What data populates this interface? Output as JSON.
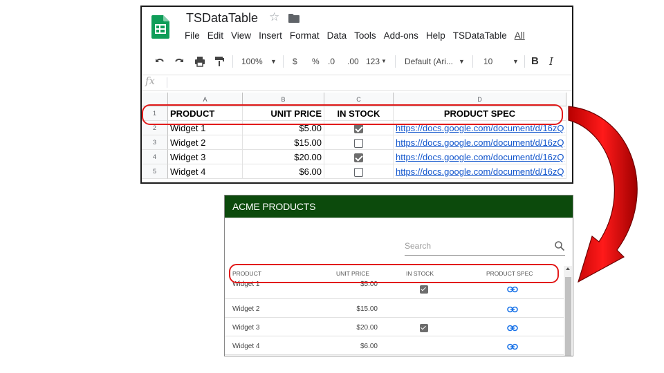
{
  "sheet": {
    "title": "TSDataTable",
    "menu": [
      "File",
      "Edit",
      "View",
      "Insert",
      "Format",
      "Data",
      "Tools",
      "Add-ons",
      "Help",
      "TSDataTable",
      "All"
    ],
    "toolbar": {
      "zoom": "100%",
      "currency": "$",
      "percent": "%",
      "dec_less": ".0",
      "dec_more": ".00",
      "more_formats": "123",
      "font": "Default (Ari...",
      "font_size": "10",
      "bold": "B",
      "italic": "I"
    },
    "fx": "fx",
    "columns": [
      "A",
      "B",
      "C",
      "D"
    ],
    "row_numbers": [
      "1",
      "2",
      "3",
      "4",
      "5"
    ],
    "headers": [
      "PRODUCT",
      "UNIT PRICE",
      "IN STOCK",
      "PRODUCT SPEC"
    ],
    "rows": [
      {
        "product": "Widget 1",
        "price": "$5.00",
        "in_stock": true,
        "spec": "https://docs.google.com/document/d/16zQ"
      },
      {
        "product": "Widget 2",
        "price": "$15.00",
        "in_stock": false,
        "spec": "https://docs.google.com/document/d/16zQ"
      },
      {
        "product": "Widget 3",
        "price": "$20.00",
        "in_stock": true,
        "spec": "https://docs.google.com/document/d/16zQ"
      },
      {
        "product": "Widget 4",
        "price": "$6.00",
        "in_stock": false,
        "spec": "https://docs.google.com/document/d/16zQ"
      }
    ]
  },
  "acme": {
    "title": "ACME PRODUCTS",
    "search_placeholder": "Search",
    "headers": [
      "PRODUCT",
      "UNIT PRICE",
      "IN STOCK",
      "PRODUCT SPEC"
    ],
    "rows": [
      {
        "product": "Widget 1",
        "price": "$5.00",
        "in_stock": true
      },
      {
        "product": "Widget 2",
        "price": "$15.00",
        "in_stock": false
      },
      {
        "product": "Widget 3",
        "price": "$20.00",
        "in_stock": true
      },
      {
        "product": "Widget 4",
        "price": "$6.00",
        "in_stock": false
      }
    ],
    "header_color": "#0c4a0c",
    "link_color": "#1a73e8"
  },
  "annotation": {
    "highlight_color": "#e21a1a",
    "arrow_color": "#d40000"
  }
}
